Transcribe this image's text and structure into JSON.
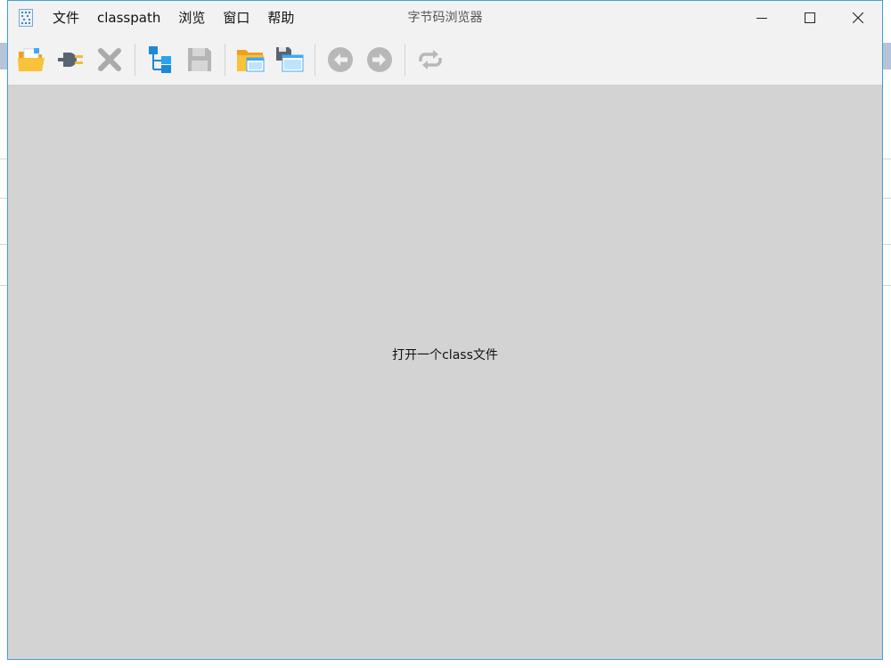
{
  "window": {
    "title": "字节码浏览器"
  },
  "menu": {
    "items": [
      {
        "label": "文件"
      },
      {
        "label": "classpath"
      },
      {
        "label": "浏览"
      },
      {
        "label": "窗口"
      },
      {
        "label": "帮助"
      }
    ]
  },
  "toolbar": {
    "buttons": [
      {
        "icon": "open-folder-icon",
        "enabled": true
      },
      {
        "icon": "plug-icon",
        "enabled": true
      },
      {
        "icon": "close-x-icon",
        "enabled": false
      },
      {
        "icon": "tree-hierarchy-icon",
        "enabled": true
      },
      {
        "icon": "save-disk-icon",
        "enabled": false
      },
      {
        "icon": "folder-window-icon",
        "enabled": true
      },
      {
        "icon": "save-window-icon",
        "enabled": true
      },
      {
        "icon": "back-arrow-icon",
        "enabled": false
      },
      {
        "icon": "forward-arrow-icon",
        "enabled": false
      },
      {
        "icon": "refresh-icon",
        "enabled": false
      }
    ]
  },
  "main": {
    "placeholder": "打开一个class文件"
  },
  "colors": {
    "window_border": "#3fa3d8",
    "chrome": "#f2f2f2",
    "content_bg": "#d3d3d3",
    "folder_yellow": "#f6b93b",
    "tree_blue": "#1e88d8",
    "disabled_gray": "#bdbdbd"
  }
}
